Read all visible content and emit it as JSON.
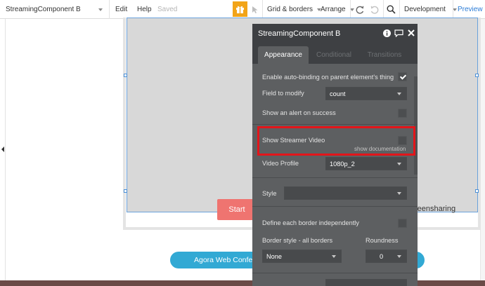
{
  "topbar": {
    "page_name": "StreamingComponent B",
    "menu_edit": "Edit",
    "menu_help": "Help",
    "saved_status": "Saved",
    "grid_borders": "Grid & borders",
    "arrange": "Arrange",
    "environment": "Development",
    "preview": "Preview"
  },
  "canvas": {
    "start_button_label": "Start",
    "screensharing_label": "reensharing",
    "agora_button_label": "Agora Web Confere"
  },
  "panel": {
    "title": "StreamingComponent B",
    "tabs": [
      {
        "label": "Appearance",
        "active": true
      },
      {
        "label": "Conditional",
        "active": false
      },
      {
        "label": "Transitions",
        "active": false
      }
    ],
    "auto_binding_label": "Enable auto-binding on parent element's thing",
    "auto_binding_checked": true,
    "field_to_modify_label": "Field to modify",
    "field_to_modify_value": "count",
    "show_alert_label": "Show an alert on success",
    "show_alert_checked": false,
    "show_video_label": "Show Streamer Video",
    "show_video_checked": false,
    "show_documentation": "show documentation",
    "video_profile_label": "Video Profile",
    "video_profile_value": "1080p_2",
    "style_label": "Style",
    "style_value": "",
    "define_border_label": "Define each border independently",
    "define_border_checked": false,
    "border_style_label": "Border style - all borders",
    "roundness_label": "Roundness",
    "border_style_value": "None",
    "roundness_value": "0"
  },
  "colors": {
    "accent": "#2a7bd6",
    "gift": "#f2a418",
    "panel_bg": "#5d5f61",
    "panel_header": "#3e4043",
    "highlight": "#e3151a",
    "start_button": "#ef7470",
    "agora_button": "#32a9d4"
  }
}
